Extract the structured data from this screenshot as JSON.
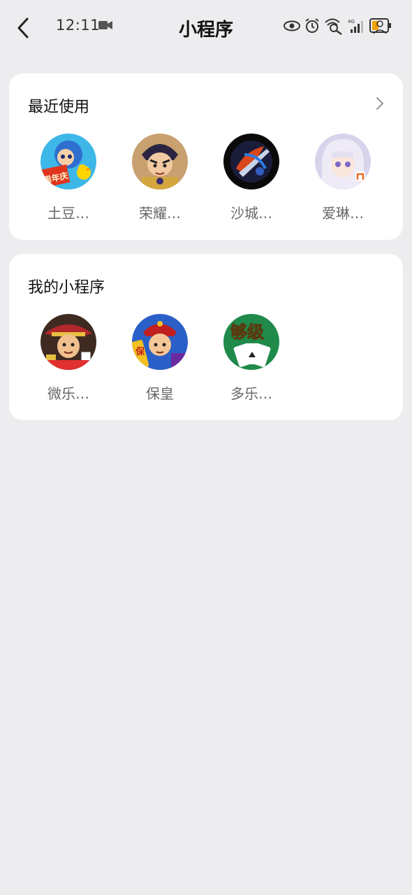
{
  "status_bar": {
    "time": "12:11"
  },
  "header": {
    "title": "小程序"
  },
  "recent": {
    "title": "最近使用",
    "items": [
      {
        "label": "土豆…",
        "icon": "tudou-game-icon"
      },
      {
        "label": "荣耀…",
        "icon": "rongyao-game-icon"
      },
      {
        "label": "沙城…",
        "icon": "shacheng-game-icon"
      },
      {
        "label": "爱琳…",
        "icon": "ailin-game-icon"
      }
    ]
  },
  "mine": {
    "title": "我的小程序",
    "items": [
      {
        "label": "微乐…",
        "icon": "weile-game-icon"
      },
      {
        "label": "保皇",
        "icon": "baohuang-game-icon"
      },
      {
        "label": "多乐…",
        "icon": "duole-game-icon"
      }
    ]
  },
  "icon_badges": {
    "tudou": "周年庆",
    "baohuang": "保",
    "duole": "够级"
  }
}
